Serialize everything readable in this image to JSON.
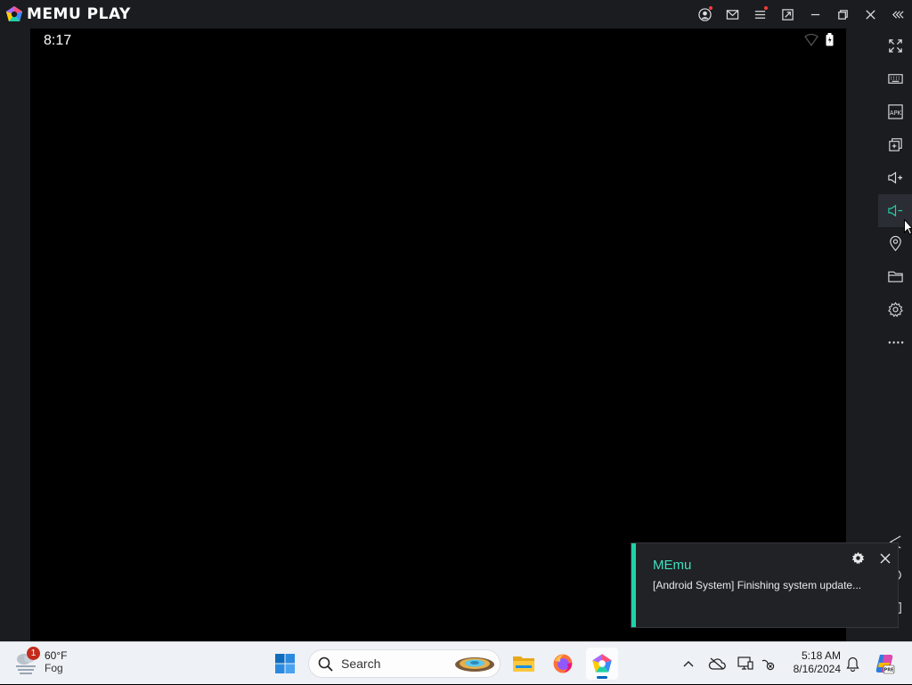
{
  "window": {
    "app_name": "MEMU PLAY",
    "accent": "#1fd1a6"
  },
  "titlebar": {
    "buttons": [
      "account-icon",
      "mail-icon",
      "menu-icon",
      "screen-rotate-icon",
      "minimize-icon",
      "restore-icon",
      "close-icon",
      "collapse-sidebar-icon"
    ]
  },
  "android": {
    "time": "8:17"
  },
  "sidebar": {
    "items": [
      {
        "name": "fullscreen",
        "icon": "expand-icon"
      },
      {
        "name": "keymapping",
        "icon": "keyboard-icon"
      },
      {
        "name": "install-apk",
        "icon": "apk-icon"
      },
      {
        "name": "multi-instance",
        "icon": "multi-window-icon"
      },
      {
        "name": "volume-up",
        "icon": "volume-up-icon"
      },
      {
        "name": "volume-down",
        "icon": "volume-down-icon"
      },
      {
        "name": "location",
        "icon": "location-pin-icon"
      },
      {
        "name": "shared-folder",
        "icon": "folder-icon"
      },
      {
        "name": "settings",
        "icon": "gear-icon"
      },
      {
        "name": "more",
        "icon": "more-icon"
      }
    ]
  },
  "notification": {
    "title": "MEmu",
    "message": "[Android System] Finishing system update..."
  },
  "taskbar": {
    "weather": {
      "badge": "1",
      "temperature": "60°F",
      "condition": "Fog"
    },
    "search_placeholder": "Search",
    "clock": {
      "time": "5:18 AM",
      "date": "8/16/2024"
    }
  }
}
